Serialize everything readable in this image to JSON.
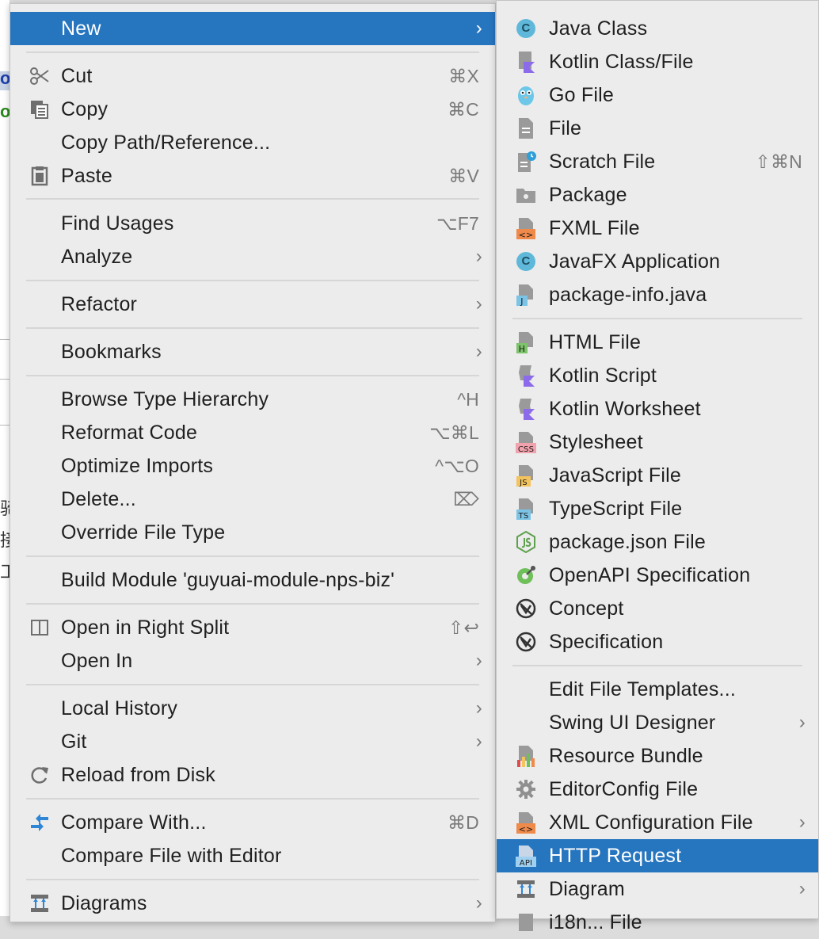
{
  "background": {
    "chars": [
      "ol",
      "ol",
      "骑",
      "接",
      "工"
    ]
  },
  "main_menu": {
    "new": {
      "label": "New"
    },
    "cut": {
      "label": "Cut",
      "shortcut": "⌘X"
    },
    "copy": {
      "label": "Copy",
      "shortcut": "⌘C"
    },
    "copy_path": {
      "label": "Copy Path/Reference..."
    },
    "paste": {
      "label": "Paste",
      "shortcut": "⌘V"
    },
    "find_usages": {
      "label": "Find Usages",
      "shortcut": "⌥F7"
    },
    "analyze": {
      "label": "Analyze"
    },
    "refactor": {
      "label": "Refactor"
    },
    "bookmarks": {
      "label": "Bookmarks"
    },
    "browse_type_hierarchy": {
      "label": "Browse Type Hierarchy",
      "shortcut": "^H"
    },
    "reformat_code": {
      "label": "Reformat Code",
      "shortcut": "⌥⌘L"
    },
    "optimize_imports": {
      "label": "Optimize Imports",
      "shortcut": "^⌥O"
    },
    "delete": {
      "label": "Delete...",
      "shortcut": "⌦"
    },
    "override_file_type": {
      "label": "Override File Type"
    },
    "build_module": {
      "label": "Build Module 'guyuai-module-nps-biz'"
    },
    "open_right_split": {
      "label": "Open in Right Split",
      "shortcut": "⇧↩"
    },
    "open_in": {
      "label": "Open In"
    },
    "local_history": {
      "label": "Local History"
    },
    "git": {
      "label": "Git"
    },
    "reload_from_disk": {
      "label": "Reload from Disk"
    },
    "compare_with": {
      "label": "Compare With...",
      "shortcut": "⌘D"
    },
    "compare_file_editor": {
      "label": "Compare File with Editor"
    },
    "diagrams": {
      "label": "Diagrams"
    },
    "arrow_glyph": "›"
  },
  "sub_menu": {
    "java_class": {
      "label": "Java Class"
    },
    "kotlin_class": {
      "label": "Kotlin Class/File"
    },
    "go_file": {
      "label": "Go File"
    },
    "file": {
      "label": "File"
    },
    "scratch_file": {
      "label": "Scratch File",
      "shortcut": "⇧⌘N"
    },
    "package": {
      "label": "Package"
    },
    "fxml_file": {
      "label": "FXML File"
    },
    "javafx_app": {
      "label": "JavaFX Application"
    },
    "package_info": {
      "label": "package-info.java"
    },
    "html_file": {
      "label": "HTML File"
    },
    "kotlin_script": {
      "label": "Kotlin Script"
    },
    "kotlin_worksheet": {
      "label": "Kotlin Worksheet"
    },
    "stylesheet": {
      "label": "Stylesheet"
    },
    "javascript_file": {
      "label": "JavaScript File"
    },
    "typescript_file": {
      "label": "TypeScript File"
    },
    "package_json": {
      "label": "package.json File"
    },
    "openapi_spec": {
      "label": "OpenAPI Specification"
    },
    "concept": {
      "label": "Concept"
    },
    "specification": {
      "label": "Specification"
    },
    "edit_file_templates": {
      "label": "Edit File Templates..."
    },
    "swing_ui_designer": {
      "label": "Swing UI Designer"
    },
    "resource_bundle": {
      "label": "Resource Bundle"
    },
    "editorconfig_file": {
      "label": "EditorConfig File"
    },
    "xml_config_file": {
      "label": "XML Configuration File"
    },
    "http_request": {
      "label": "HTTP Request"
    },
    "diagram": {
      "label": "Diagram"
    },
    "last_partial": {
      "label": "i18n... File"
    }
  },
  "icon_badges": {
    "java_c": "C",
    "fxml": "<>",
    "javafx_c": "C",
    "package_info": "J",
    "html": "H",
    "css": "CSS",
    "js": "JS",
    "ts": "TS",
    "xml": "<>",
    "api": "API"
  },
  "colors": {
    "selection": "#2675bf",
    "menu_bg": "#ececec",
    "shortcut": "#7a7a7a",
    "separator": "#d6d6d6"
  }
}
